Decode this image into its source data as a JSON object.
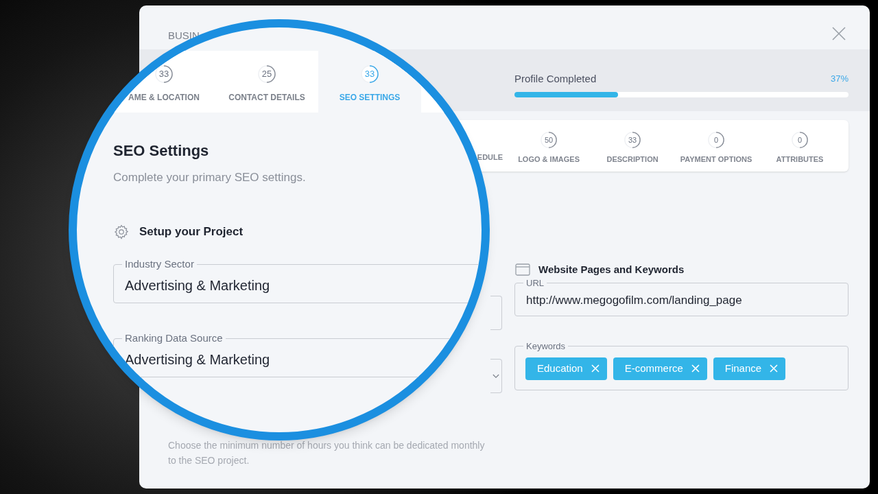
{
  "window": {
    "title": "BUSIN"
  },
  "main_tabs": [
    {
      "badge": "33",
      "label": "AME & LOCATION",
      "selected": false
    },
    {
      "badge": "25",
      "label": "CONTACT DETAILS",
      "selected": false
    },
    {
      "badge": "33",
      "label": "SEO SETTINGS",
      "selected": true
    }
  ],
  "profile": {
    "label": "Profile Completed",
    "percent": "37%",
    "level": 0.31
  },
  "sub_tabs": [
    {
      "label": "EDULE"
    },
    {
      "badge": "50",
      "label": "LOGO & IMAGES"
    },
    {
      "badge": "33",
      "label": "DESCRIPTION"
    },
    {
      "badge": "0",
      "label": "PAYMENT OPTIONS"
    },
    {
      "badge": "0",
      "label": "ATTRIBUTES"
    }
  ],
  "section": {
    "title": "SEO Settings",
    "subtitle": "Complete your primary SEO settings."
  },
  "project": {
    "title": "Setup your Project",
    "fields": [
      {
        "label": "Industry Sector",
        "value": "Advertising & Marketing"
      },
      {
        "label": "Ranking Data Source",
        "value": "Advertising & Marketing"
      }
    ]
  },
  "website": {
    "title": "Website Pages and Keywords",
    "url": {
      "label": "URL",
      "value": "http://www.megogofilm.com/landing_page"
    },
    "keywords": {
      "label": "Keywords",
      "tags": [
        "Education",
        "E-commerce",
        "Finance"
      ]
    }
  },
  "hours": {
    "description": "Choose the minimum number of hours you think can be dedicated monthly to the SEO project."
  }
}
